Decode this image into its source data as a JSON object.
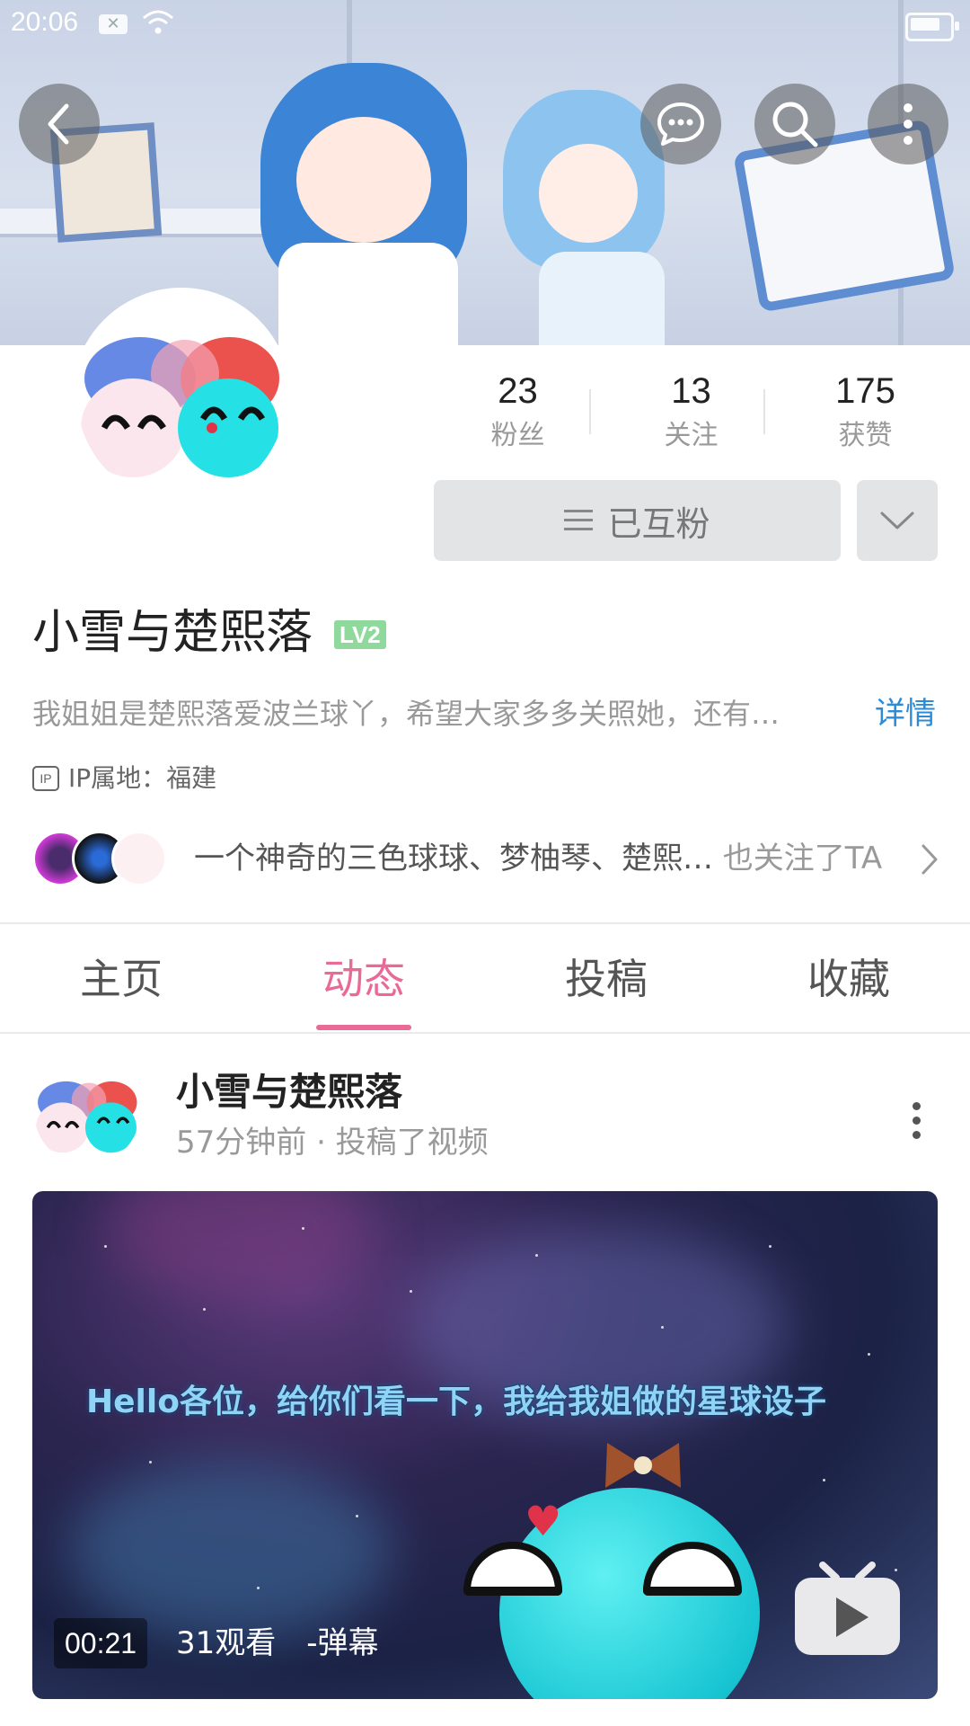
{
  "status_bar": {
    "time": "20:06"
  },
  "stats": [
    {
      "value": "23",
      "label": "粉丝"
    },
    {
      "value": "13",
      "label": "关注"
    },
    {
      "value": "175",
      "label": "获赞"
    }
  ],
  "follow_button": {
    "label": "已互粉"
  },
  "profile": {
    "name": "小雪与楚熙落",
    "level": "LV2",
    "bio": "我姐姐是楚熙落爱波兰球丫，希望大家多多关照她，还有…",
    "detail_link": "详情",
    "ip_label": "IP属地：福建"
  },
  "mutual_follow": {
    "names": "一个神奇的三色球球、梦柚琴、楚熙…",
    "suffix": " 也关注了TA"
  },
  "tabs": [
    {
      "label": "主页",
      "active": false
    },
    {
      "label": "动态",
      "active": true
    },
    {
      "label": "投稿",
      "active": false
    },
    {
      "label": "收藏",
      "active": false
    }
  ],
  "post": {
    "author": "小雪与楚熙落",
    "meta": "57分钟前 · 投稿了视频",
    "video": {
      "caption": "Hello各位，给你们看一下，我给我姐做的星球设子",
      "duration": "00:21",
      "stats": "31观看　-弹幕"
    }
  },
  "colors": {
    "accent_pink": "#ea6a97",
    "link_blue": "#2c8bd6",
    "level_green": "#8fd99c",
    "button_grey": "#e3e4e6"
  },
  "icons": [
    "back-icon",
    "message-icon",
    "search-icon",
    "more-vertical-icon",
    "chevron-down-icon",
    "chevron-right-icon",
    "menu-lines-icon",
    "ip-icon",
    "play-icon"
  ]
}
